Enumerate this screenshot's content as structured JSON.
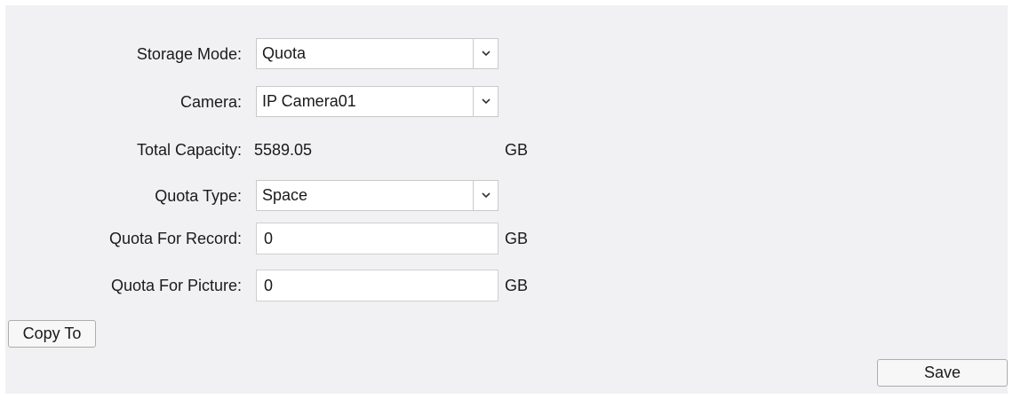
{
  "form": {
    "storage_mode": {
      "label": "Storage Mode:",
      "value": "Quota"
    },
    "camera": {
      "label": "Camera:",
      "value": "IP Camera01"
    },
    "total_capacity": {
      "label": "Total Capacity:",
      "value": "5589.05",
      "unit": "GB"
    },
    "quota_type": {
      "label": "Quota Type:",
      "value": "Space"
    },
    "quota_record": {
      "label": "Quota For Record:",
      "value": "0",
      "unit": "GB"
    },
    "quota_picture": {
      "label": "Quota For Picture:",
      "value": "0",
      "unit": "GB"
    }
  },
  "buttons": {
    "copy_to": "Copy To",
    "save": "Save"
  },
  "icons": {
    "dropdown": "chevron-down-icon"
  }
}
